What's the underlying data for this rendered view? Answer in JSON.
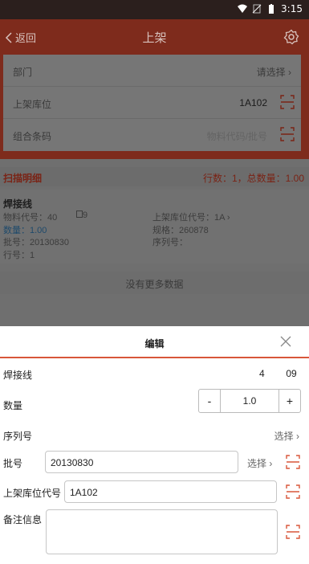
{
  "status": {
    "time": "3:15"
  },
  "appbar": {
    "back_label": "返回",
    "title": "上架"
  },
  "header": {
    "dept_label": "部门",
    "dept_value": "请选择",
    "loc_label": "上架库位",
    "loc_value": "1A102",
    "barcode_label": "组合条码",
    "barcode_placeholder": "物料代码/批号"
  },
  "scan_section": {
    "title": "扫描明细",
    "summary": "行数：1，总数量：1.00"
  },
  "item": {
    "name": "焊接线",
    "code": "物料代号：40",
    "code_tail": "9",
    "qty": "数量：1.00",
    "batch": "批号：20130830",
    "line": "行号：1",
    "loc_code": "上架库位代号：1A",
    "spec": "规格：260878",
    "serial": "序列号："
  },
  "no_more": "没有更多数据",
  "dialog": {
    "title": "编辑",
    "item_name": "焊接线",
    "item_code_a": "4",
    "item_code_b": "09",
    "qty_label": "数量",
    "qty_minus": "-",
    "qty_value": "1.0",
    "qty_plus": "+",
    "serial_label": "序列号",
    "serial_select": "选择",
    "batch_label": "批号",
    "batch_value": "20130830",
    "batch_select": "选择",
    "loc_label": "上架库位代号",
    "loc_value": "1A102",
    "remark_label": "备注信息",
    "remark_value": ""
  },
  "colors": {
    "accent": "#d8563a",
    "appbar_dim": "#7e2b1c",
    "overlay_bg": "#6f6f6f"
  }
}
